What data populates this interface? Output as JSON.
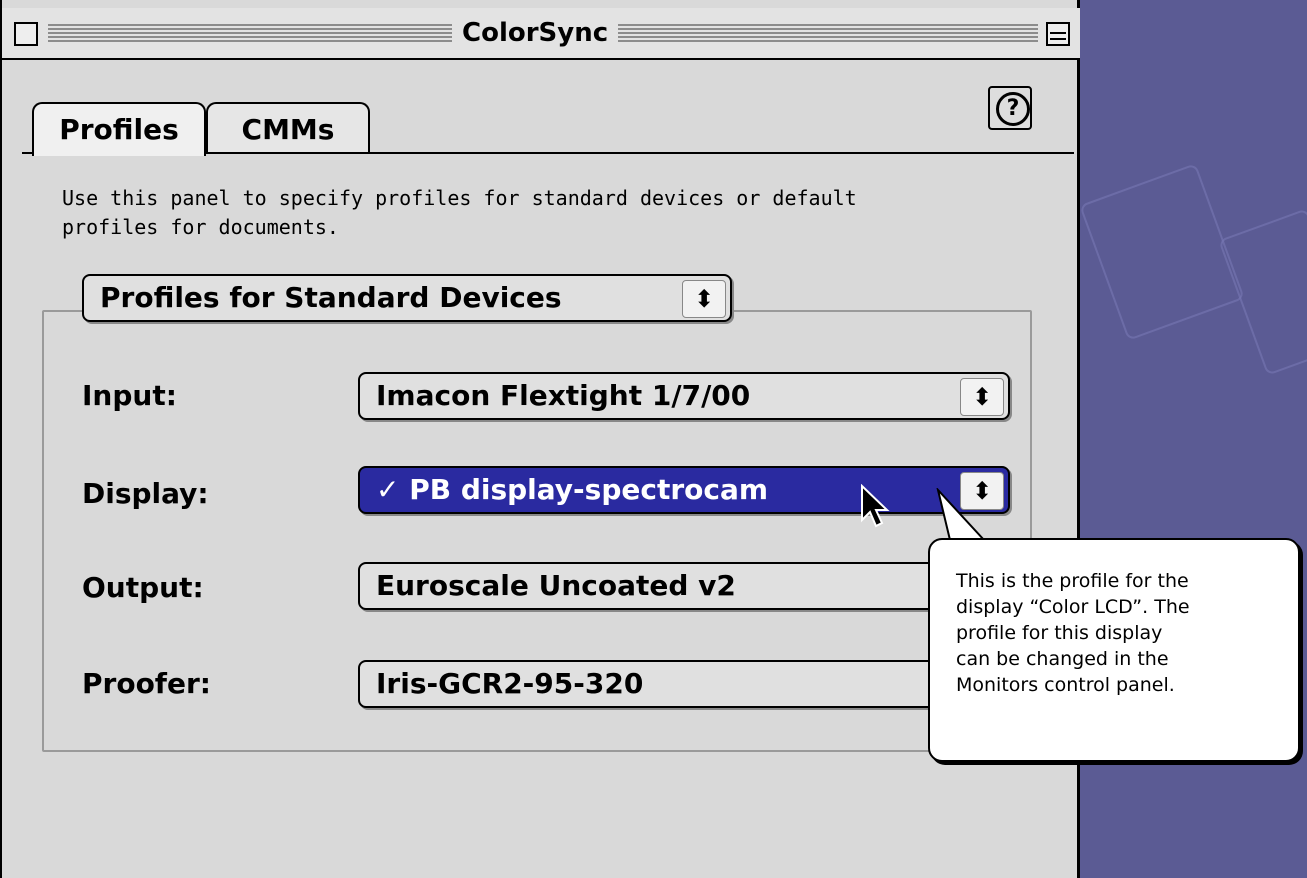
{
  "window": {
    "title": "ColorSync"
  },
  "tabs": [
    {
      "label": "Profiles",
      "active": true
    },
    {
      "label": "CMMs",
      "active": false
    }
  ],
  "help": {
    "label": "?"
  },
  "description": "Use this panel to specify profiles for standard devices or default profiles for documents.",
  "group_popup": {
    "value": "Profiles for Standard Devices"
  },
  "rows": [
    {
      "label": "Input:",
      "value": "Imacon Flextight 1/7/00",
      "selected": false
    },
    {
      "label": "Display:",
      "value": "✓ PB display-spectrocam",
      "selected": true
    },
    {
      "label": "Output:",
      "value": "Euroscale Uncoated v2",
      "selected": false
    },
    {
      "label": "Proofer:",
      "value": "Iris-GCR2-95-320",
      "selected": false
    }
  ],
  "help_balloon": {
    "text": "This is the profile for the\ndisplay “Color LCD”. The\nprofile for this display\ncan be changed in the\nMonitors control panel."
  },
  "colors": {
    "desktop": "#5b5b94",
    "selected_popup": "#2a2aa0",
    "window_bg": "#d9d9d9"
  }
}
